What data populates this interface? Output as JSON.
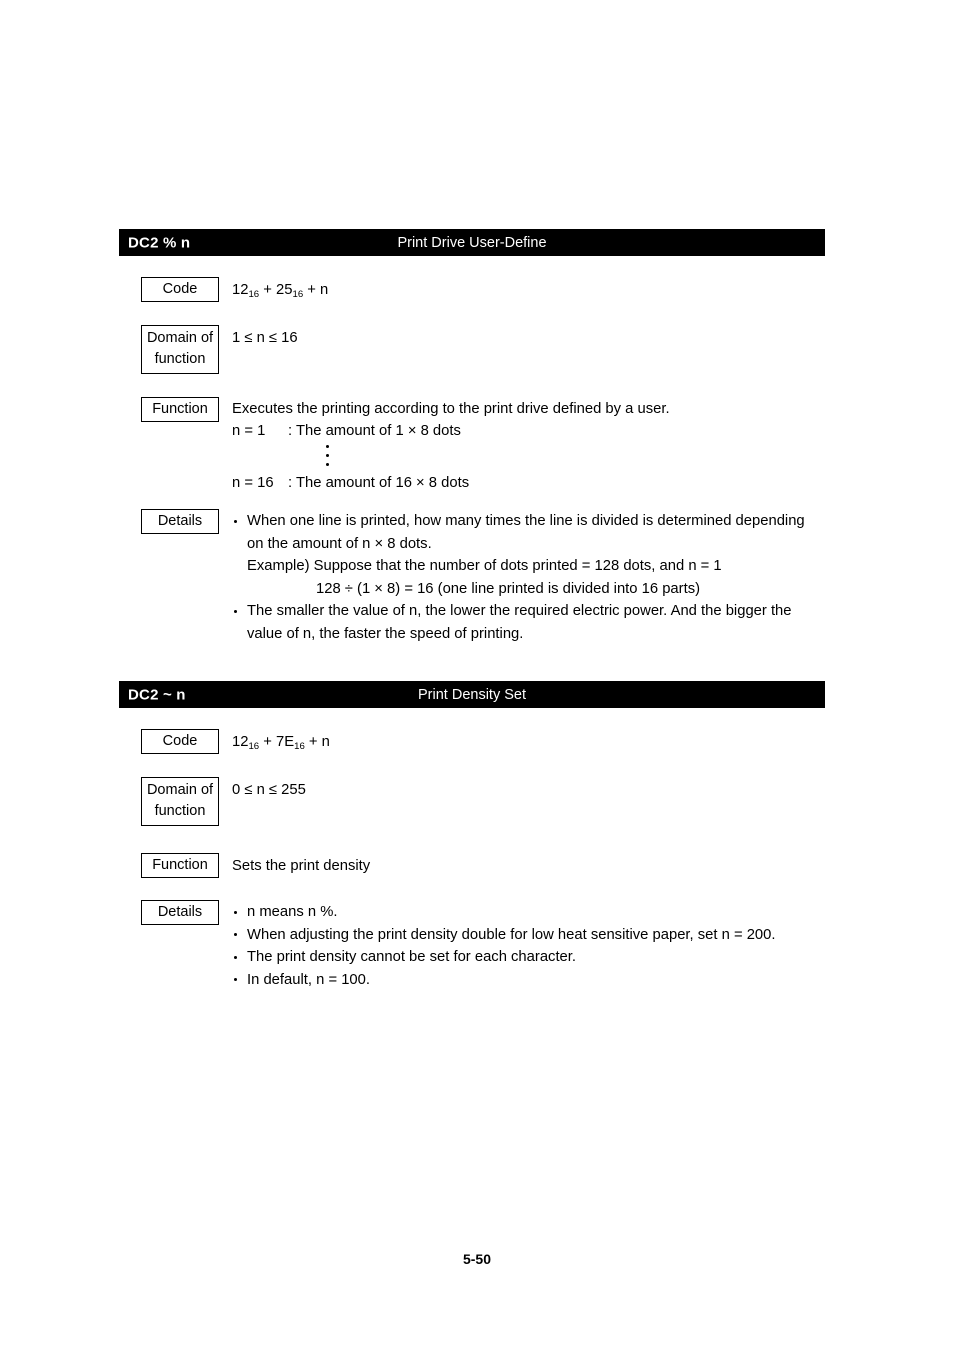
{
  "page": {
    "number": "5-50"
  },
  "sections": [
    {
      "command": "DC2 % n",
      "title": "Print Drive User-Define",
      "code_label": "Code",
      "code_value_parts": {
        "a": "12",
        "a_sub": "16",
        "plus1": " + ",
        "b": "25",
        "b_sub": "16",
        "plus2": " + n"
      },
      "domain_label_line1": "Domain of",
      "domain_label_line2": "function",
      "domain_value": "1 ≤ n ≤ 16",
      "function_label": "Function",
      "function_intro": "Executes the printing according to the print drive defined by a user.",
      "function_case_1_key": "n = 1",
      "function_case_1_value": ": The amount of 1 × 8 dots",
      "function_case_2_key": "n = 16",
      "function_case_2_value": ": The amount of 16 × 8 dots",
      "details_label": "Details",
      "details_bullets": [
        "When one line is printed, how many times the line is divided is determined depending on the amount of n × 8 dots.",
        "The smaller the value of n, the lower the required electric power. And the bigger the value of n, the faster the speed of printing."
      ],
      "example_line_1": "Example)   Suppose that the number of dots printed = 128 dots, and n = 1",
      "example_line_2": "128 ÷ (1 × 8) = 16 (one line printed is divided into 16 parts)"
    },
    {
      "command": "DC2 ~ n",
      "title": "Print Density Set",
      "code_label": "Code",
      "code_value_parts": {
        "a": "12",
        "a_sub": "16",
        "plus1": " + ",
        "b": "7E",
        "b_sub": "16",
        "plus2": " + n"
      },
      "domain_label_line1": "Domain of",
      "domain_label_line2": "function",
      "domain_value": "0 ≤ n ≤ 255",
      "function_label": "Function",
      "function_intro": "Sets the print density",
      "details_label": "Details",
      "details_bullets": [
        "n means n %.",
        "When adjusting the print density double for low heat sensitive paper, set n = 200.",
        "The print density cannot be set for each character.",
        "In default, n = 100."
      ]
    }
  ]
}
